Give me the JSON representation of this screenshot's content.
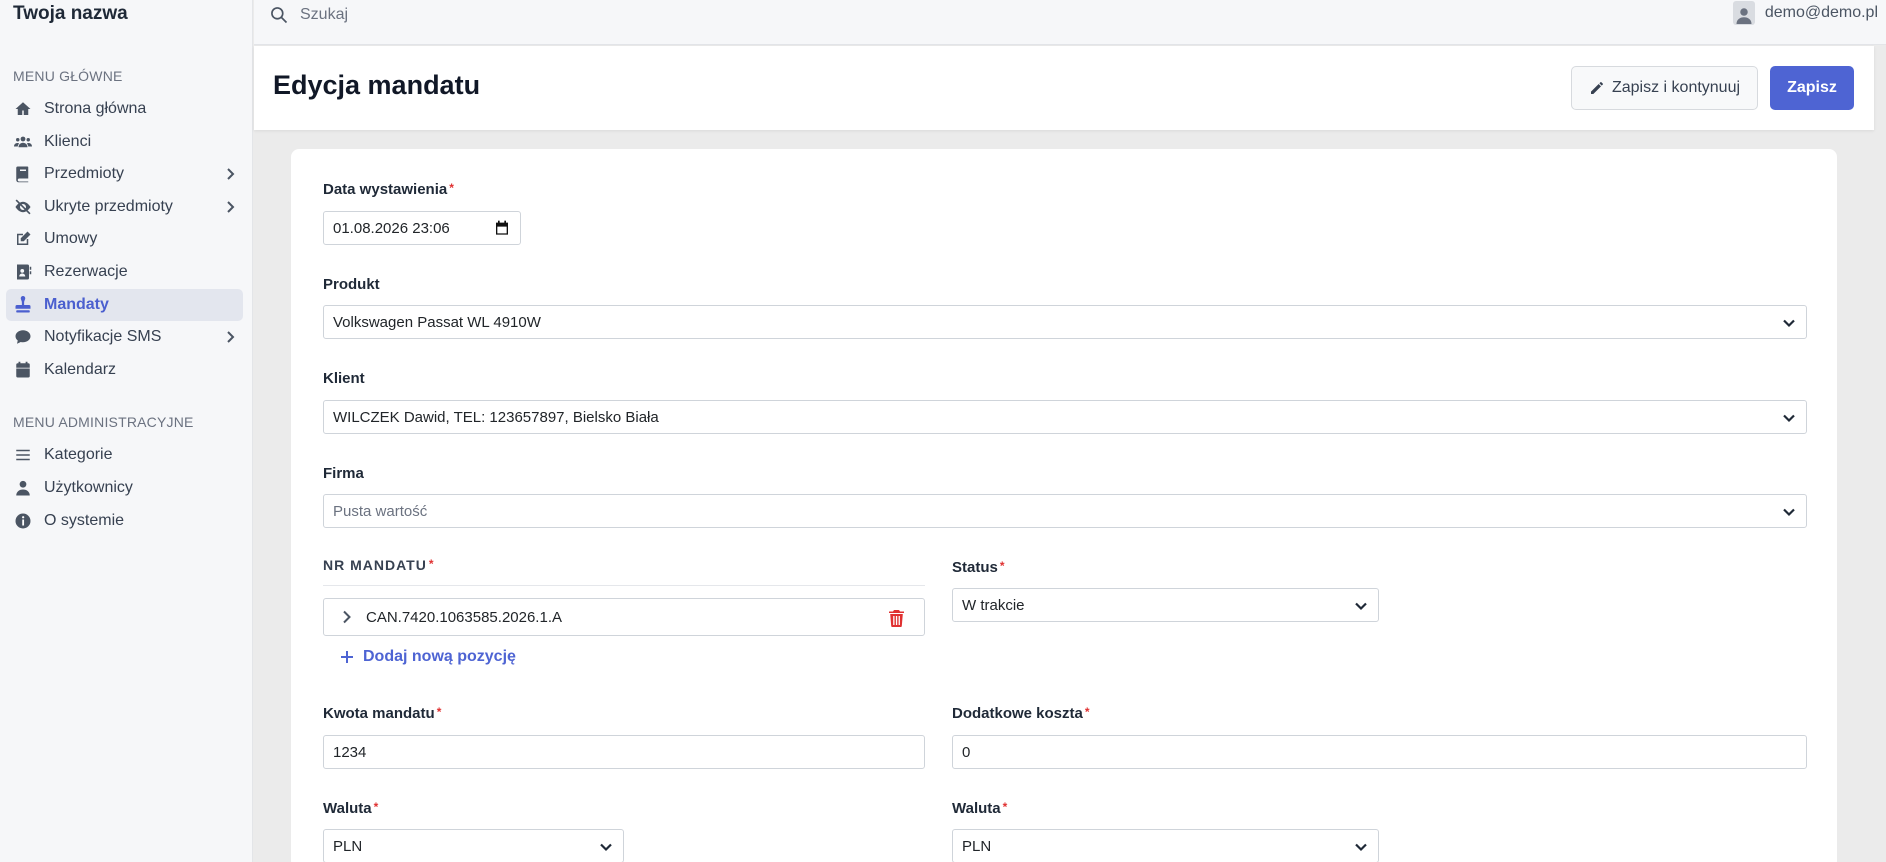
{
  "app": {
    "brand": "Twoja nazwa"
  },
  "topbar": {
    "search_placeholder": "Szukaj",
    "user_email": "demo@demo.pl"
  },
  "sidebar": {
    "main_section": "MENU GŁÓWNE",
    "main_items": [
      {
        "label": "Strona główna",
        "icon": "home-icon"
      },
      {
        "label": "Klienci",
        "icon": "users-icon"
      },
      {
        "label": "Przedmioty",
        "icon": "book-icon",
        "has_submenu": true
      },
      {
        "label": "Ukryte przedmioty",
        "icon": "eye-slash-icon",
        "has_submenu": true
      },
      {
        "label": "Umowy",
        "icon": "edit-icon"
      },
      {
        "label": "Rezerwacje",
        "icon": "address-card-icon"
      },
      {
        "label": "Mandaty",
        "icon": "stamp-icon",
        "active": true
      },
      {
        "label": "Notyfikacje SMS",
        "icon": "comment-icon",
        "has_submenu": true
      },
      {
        "label": "Kalendarz",
        "icon": "calendar-icon"
      }
    ],
    "admin_section": "MENU ADMINISTRACYJNE",
    "admin_items": [
      {
        "label": "Kategorie",
        "icon": "bars-icon"
      },
      {
        "label": "Użytkownicy",
        "icon": "user-icon"
      },
      {
        "label": "O systemie",
        "icon": "info-icon"
      }
    ]
  },
  "header": {
    "title": "Edycja mandatu",
    "save_continue_label": "Zapisz i kontynuuj",
    "save_label": "Zapisz"
  },
  "form": {
    "issue_date": {
      "label": "Data wystawienia",
      "value": "01.08.2026 23:06"
    },
    "product": {
      "label": "Produkt",
      "value": "Volkswagen Passat WL 4910W"
    },
    "client": {
      "label": "Klient",
      "value": "WILCZEK Dawid, TEL: 123657897, Bielsko Biała"
    },
    "company": {
      "label": "Firma",
      "placeholder": "Pusta wartość"
    },
    "mandate_numbers": {
      "label": "NR MANDATU",
      "items": [
        "CAN.7420.1063585.2026.1.A"
      ],
      "add_label": "Dodaj nową pozycję"
    },
    "status": {
      "label": "Status",
      "value": "W trakcie"
    },
    "amount": {
      "label": "Kwota mandatu",
      "value": "1234"
    },
    "extra_costs": {
      "label": "Dodatkowe koszta",
      "value": "0"
    },
    "currency_amount": {
      "label": "Waluta",
      "value": "PLN"
    },
    "currency_costs": {
      "label": "Waluta",
      "value": "PLN"
    }
  },
  "colors": {
    "accent": "#4e64d3",
    "required": "#e03131",
    "active_bg": "#e3e6ee"
  }
}
